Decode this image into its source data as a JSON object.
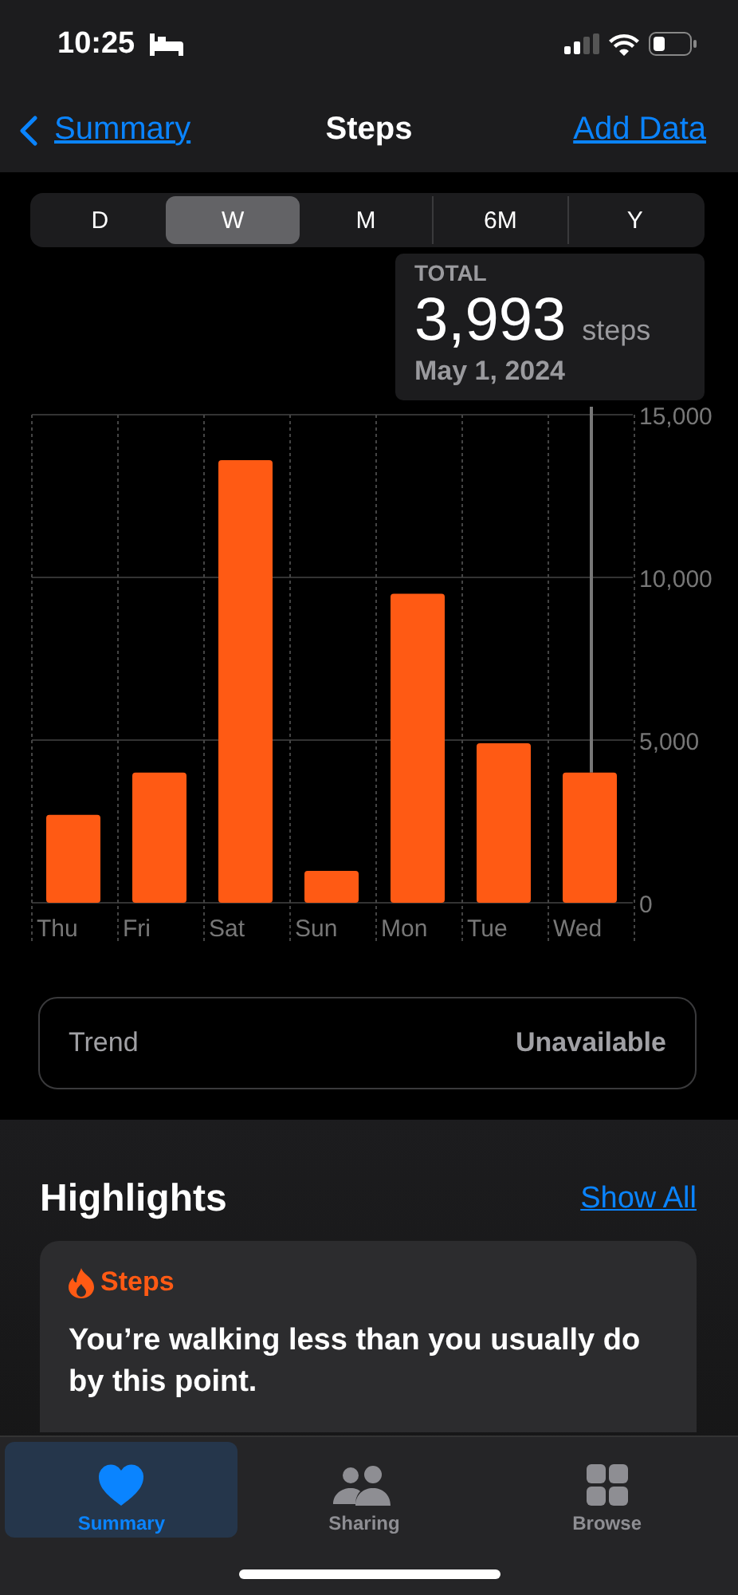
{
  "status_bar": {
    "time": "10:25"
  },
  "nav": {
    "back": "Summary",
    "title": "Steps",
    "action": "Add Data"
  },
  "segments": [
    {
      "label": "D",
      "selected": false
    },
    {
      "label": "W",
      "selected": true
    },
    {
      "label": "M",
      "selected": false
    },
    {
      "label": "6M",
      "selected": false
    },
    {
      "label": "Y",
      "selected": false
    }
  ],
  "total": {
    "label": "TOTAL",
    "value": "3,993",
    "unit": "steps",
    "date": "May 1, 2024"
  },
  "chart_data": {
    "type": "bar",
    "categories": [
      "Thu",
      "Fri",
      "Sat",
      "Sun",
      "Mon",
      "Tue",
      "Wed"
    ],
    "values": [
      2700,
      4000,
      13600,
      980,
      9500,
      4900,
      4000
    ],
    "ylim": [
      0,
      15000
    ],
    "yticks": [
      {
        "value": 0,
        "label": "0"
      },
      {
        "value": 5000,
        "label": "5,000"
      },
      {
        "value": 10000,
        "label": "10,000"
      },
      {
        "value": 15000,
        "label": "15,000"
      }
    ]
  },
  "trend": {
    "label": "Trend",
    "value": "Unavailable"
  },
  "highlights": {
    "title": "Highlights",
    "show_all": "Show All",
    "card": {
      "category": "Steps",
      "text": "You’re walking less than you usually do by this point."
    }
  },
  "tab_bar": [
    {
      "label": "Summary",
      "selected": true
    },
    {
      "label": "Sharing",
      "selected": false
    },
    {
      "label": "Browse",
      "selected": false
    }
  ]
}
